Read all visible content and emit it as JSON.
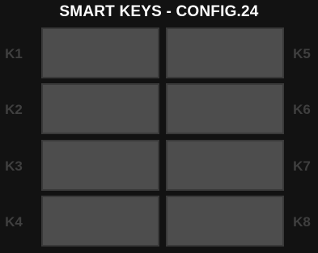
{
  "title": "SMART KEYS - CONFIG.24",
  "left_keys": [
    {
      "label": "K1"
    },
    {
      "label": "K2"
    },
    {
      "label": "K3"
    },
    {
      "label": "K4"
    }
  ],
  "right_keys": [
    {
      "label": "K5"
    },
    {
      "label": "K6"
    },
    {
      "label": "K7"
    },
    {
      "label": "K8"
    }
  ],
  "colors": {
    "background": "#121212",
    "key_fill": "#4d4d4d",
    "key_border": "#3a3a3a",
    "label": "#3f3f3f",
    "title": "#ffffff"
  }
}
